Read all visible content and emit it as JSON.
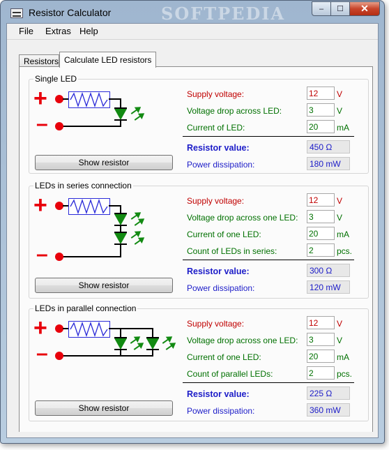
{
  "window": {
    "title": "Resistor Calculator",
    "watermark": "SOFTPEDIA"
  },
  "caption_buttons": {
    "minimize": "–",
    "maximize": "☐",
    "close": "✕"
  },
  "menu": [
    "File",
    "Extras",
    "Help"
  ],
  "tabs": [
    {
      "label": "Resistors",
      "active": false
    },
    {
      "label": "Calculate LED resistors",
      "active": true
    }
  ],
  "colors": {
    "positive": "#e8000b",
    "led": "#128a12",
    "resistor": "#2a2ad8",
    "label_red": "#c00000",
    "label_green": "#007000",
    "label_blue": "#1c1cc8"
  },
  "icons": [
    "plus-terminal-icon",
    "minus-terminal-icon",
    "resistor-icon",
    "led-icon"
  ],
  "groups": {
    "single": {
      "title": "Single LED",
      "fields": {
        "supply": {
          "label": "Supply voltage:",
          "value": "12",
          "unit": "V"
        },
        "drop": {
          "label": "Voltage drop across LED:",
          "value": "3",
          "unit": "V"
        },
        "current": {
          "label": "Current of LED:",
          "value": "20",
          "unit": "mA"
        }
      },
      "resistor": {
        "label": "Resistor value:",
        "value": "450 Ω"
      },
      "power": {
        "label": "Power dissipation:",
        "value": "180 mW"
      },
      "button": "Show resistor"
    },
    "series": {
      "title": "LEDs in series connection",
      "fields": {
        "supply": {
          "label": "Supply voltage:",
          "value": "12",
          "unit": "V"
        },
        "drop": {
          "label": "Voltage drop across one LED:",
          "value": "3",
          "unit": "V"
        },
        "current": {
          "label": "Current of one LED:",
          "value": "20",
          "unit": "mA"
        },
        "count": {
          "label": "Count of LEDs in series:",
          "value": "2",
          "unit": "pcs."
        }
      },
      "resistor": {
        "label": "Resistor value:",
        "value": "300 Ω"
      },
      "power": {
        "label": "Power dissipation:",
        "value": "120 mW"
      },
      "button": "Show resistor"
    },
    "parallel": {
      "title": "LEDs in parallel connection",
      "fields": {
        "supply": {
          "label": "Supply voltage:",
          "value": "12",
          "unit": "V"
        },
        "drop": {
          "label": "Voltage drop across one LED:",
          "value": "3",
          "unit": "V"
        },
        "current": {
          "label": "Current of one LED:",
          "value": "20",
          "unit": "mA"
        },
        "count": {
          "label": "Count of parallel LEDs:",
          "value": "2",
          "unit": "pcs."
        }
      },
      "resistor": {
        "label": "Resistor value:",
        "value": "225 Ω"
      },
      "power": {
        "label": "Power dissipation:",
        "value": "360 mW"
      },
      "button": "Show resistor"
    }
  }
}
